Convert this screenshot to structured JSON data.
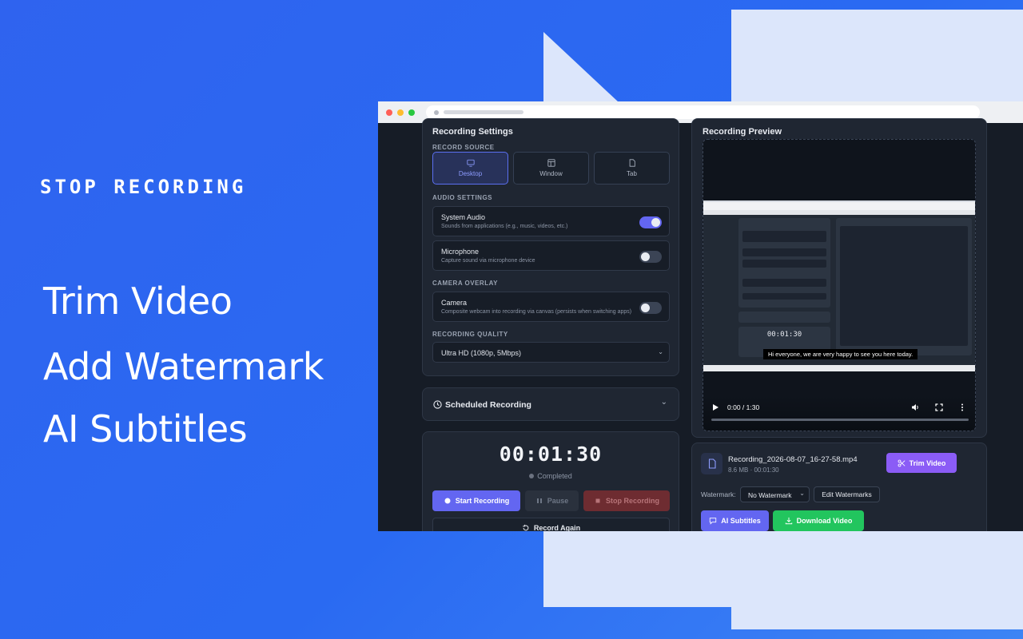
{
  "hero": {
    "kicker": "STOP RECORDING",
    "features": [
      "Trim Video",
      "Add Watermark",
      "AI Subtitles"
    ]
  },
  "settings": {
    "title": "Recording Settings",
    "record_source_label": "RECORD SOURCE",
    "sources": [
      "Desktop",
      "Window",
      "Tab"
    ],
    "audio_label": "AUDIO SETTINGS",
    "system_audio": {
      "title": "System Audio",
      "subtitle": "Sounds from applications (e.g., music, videos, etc.)",
      "on": true
    },
    "microphone": {
      "title": "Microphone",
      "subtitle": "Capture sound via microphone device",
      "on": false
    },
    "camera_label": "CAMERA OVERLAY",
    "camera": {
      "title": "Camera",
      "subtitle": "Composite webcam into recording via canvas (persists when switching apps)",
      "on": false
    },
    "quality_label": "RECORDING QUALITY",
    "quality_value": "Ultra HD (1080p, 5Mbps)"
  },
  "scheduled": {
    "title": "Scheduled Recording"
  },
  "recorder": {
    "timer": "00:01:30",
    "status": "Completed",
    "start_label": "Start Recording",
    "pause_label": "Pause",
    "stop_label": "Stop Recording",
    "again_label": "Record Again"
  },
  "preview": {
    "title": "Recording Preview",
    "subtitle_text": "Hi everyone, we are very happy to see you here today.",
    "time": "0:00 / 1:30"
  },
  "file": {
    "name": "Recording_2026-08-07_16-27-58.mp4",
    "meta": "8.6 MB · 00:01:30",
    "trim_label": "Trim Video",
    "watermark_label": "Watermark:",
    "watermark_value": "No Watermark",
    "edit_watermarks_label": "Edit Watermarks",
    "ai_subtitles_label": "AI Subtitles",
    "download_label": "Download Video"
  },
  "colors": {
    "accent": "#6366f1",
    "trim": "#8b5cf6",
    "download": "#22c55e",
    "stop": "#7f2d33"
  }
}
